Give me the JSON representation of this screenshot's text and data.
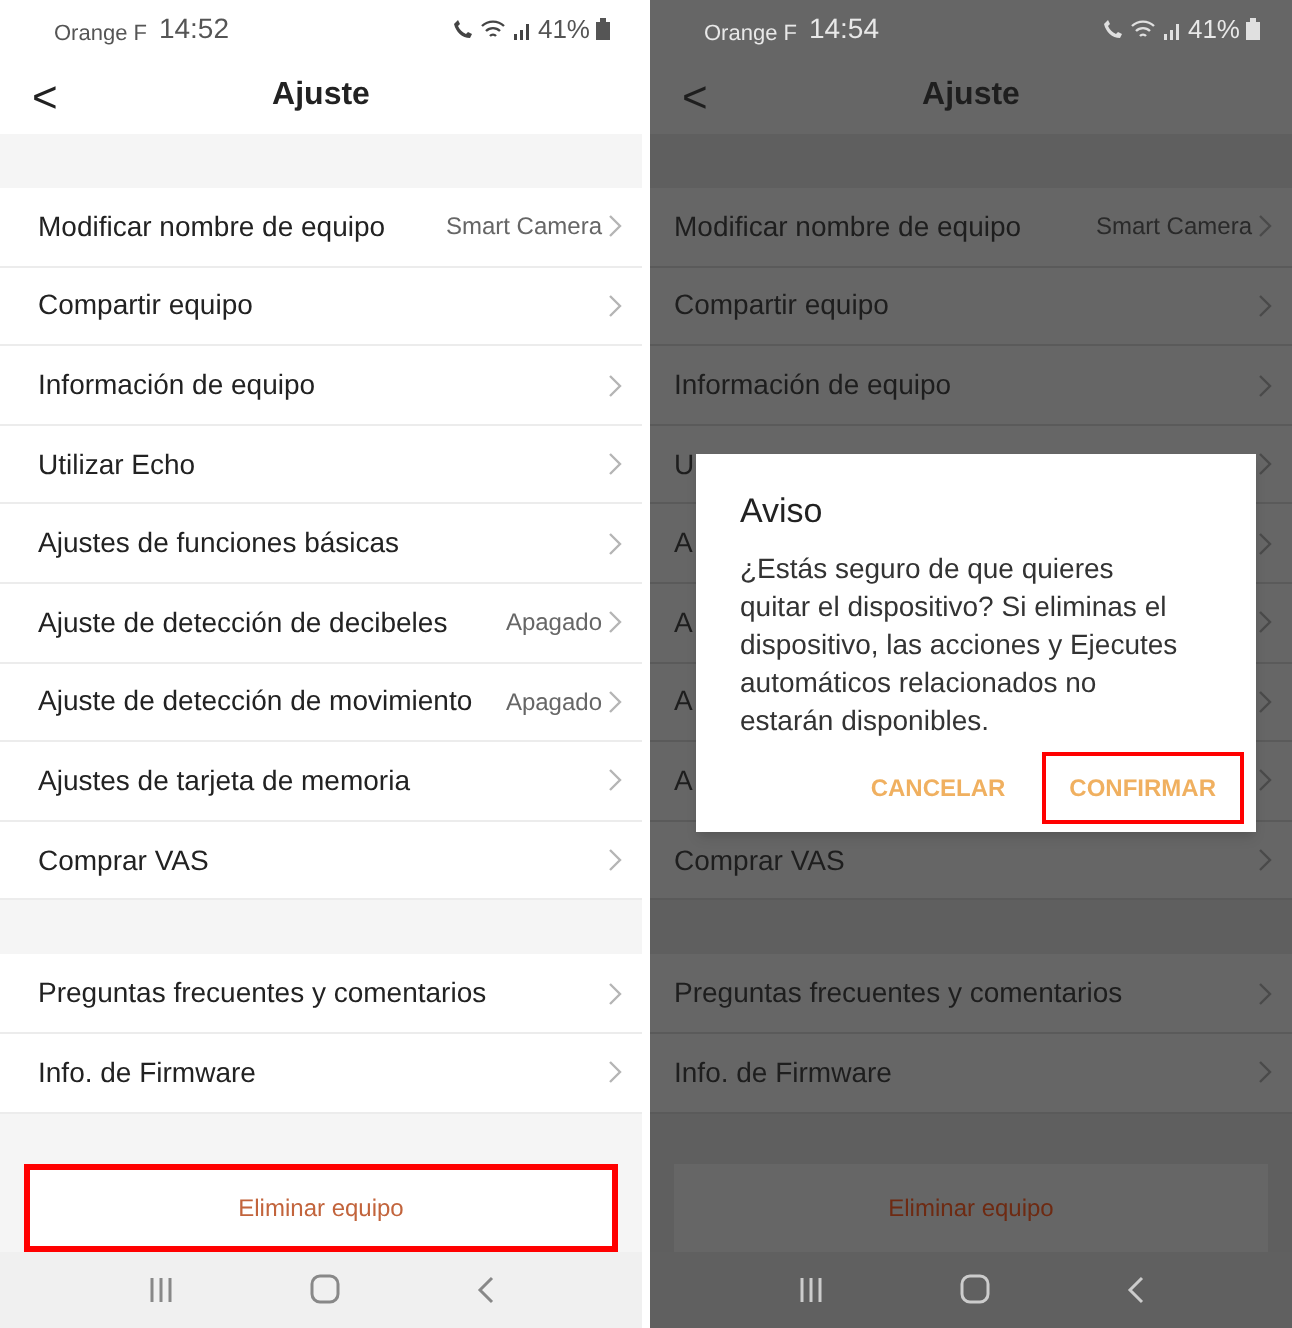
{
  "screens": [
    {
      "dimmed": false,
      "status_bar": {
        "carrier": "Orange F",
        "time": "14:52",
        "battery": "41%"
      },
      "header": {
        "back": "<",
        "title": "Ajuste"
      },
      "groups": [
        [
          {
            "label": "Modificar nombre de equipo",
            "value": "Smart Camera"
          },
          {
            "label": "Compartir equipo"
          },
          {
            "label": "Información de equipo"
          },
          {
            "label": "Utilizar Echo"
          },
          {
            "label": "Ajustes de funciones básicas"
          },
          {
            "label": "Ajuste de detección de decibeles",
            "value": "Apagado"
          },
          {
            "label": "Ajuste de detección de movimiento",
            "value": "Apagado"
          },
          {
            "label": "Ajustes de tarjeta de memoria"
          },
          {
            "label": "Comprar VAS"
          }
        ],
        [
          {
            "label": "Preguntas frecuentes y comentarios"
          },
          {
            "label": "Info. de Firmware"
          }
        ]
      ],
      "delete_button": {
        "label": "Eliminar equipo",
        "highlighted": true
      }
    },
    {
      "dimmed": true,
      "status_bar": {
        "carrier": "Orange F",
        "time": "14:54",
        "battery": "41%"
      },
      "header": {
        "back": "<",
        "title": "Ajuste"
      },
      "groups": [
        [
          {
            "label": "Modificar nombre de equipo",
            "value": "Smart Camera"
          },
          {
            "label": "Compartir equipo"
          },
          {
            "label": "Información de equipo"
          },
          {
            "label": "U"
          },
          {
            "label": "A"
          },
          {
            "label": "A"
          },
          {
            "label": "A"
          },
          {
            "label": "A"
          },
          {
            "label": "Comprar VAS"
          }
        ],
        [
          {
            "label": "Preguntas frecuentes y comentarios"
          },
          {
            "label": "Info. de Firmware"
          }
        ]
      ],
      "delete_button": {
        "label": "Eliminar equipo",
        "highlighted": false
      },
      "dialog": {
        "title": "Aviso",
        "message": "¿Estás seguro de que quieres quitar el dispositivo? Si eliminas el dispositivo, las acciones y Ejecutes automáticos relacionados no estarán disponibles.",
        "buttons": [
          {
            "label": "CANCELAR",
            "highlighted": false
          },
          {
            "label": "CONFIRMAR",
            "highlighted": true
          }
        ]
      }
    }
  ]
}
